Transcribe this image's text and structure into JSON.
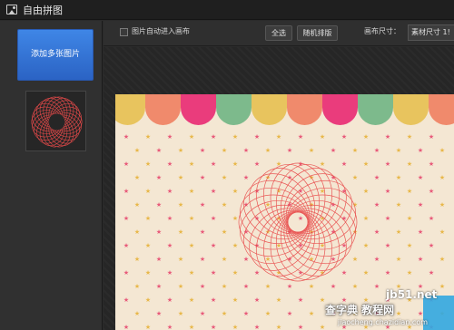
{
  "window": {
    "title": "自由拼图",
    "icon": "image-icon"
  },
  "sidebar": {
    "add_button_label": "添加多张图片",
    "thumbnail_icon": "spirograph-thumbnail"
  },
  "toolbar": {
    "auto_canvas_label": "图片自动进入画布",
    "select_all_label": "全选",
    "random_layout_label": "随机排版",
    "canvas_size_label": "画布尺寸：",
    "canvas_size_value": "素材尺寸 1!"
  },
  "canvas": {
    "background": "#f4e7d3",
    "awning_colors": [
      "#e8c45e",
      "#f08a6c",
      "#ea3c7c",
      "#7dba8c",
      "#e8c45e",
      "#f08a6c",
      "#ea3c7c",
      "#7dba8c",
      "#e8c45e",
      "#f08a6c"
    ],
    "star_colors": [
      "#e85a7a",
      "#e8b84a"
    ],
    "spiro_color": "#e84a4a"
  },
  "watermark": {
    "domain": "jb51.net",
    "site": "查字典 教程网",
    "url": "jiaocheng.chazidian.com"
  }
}
